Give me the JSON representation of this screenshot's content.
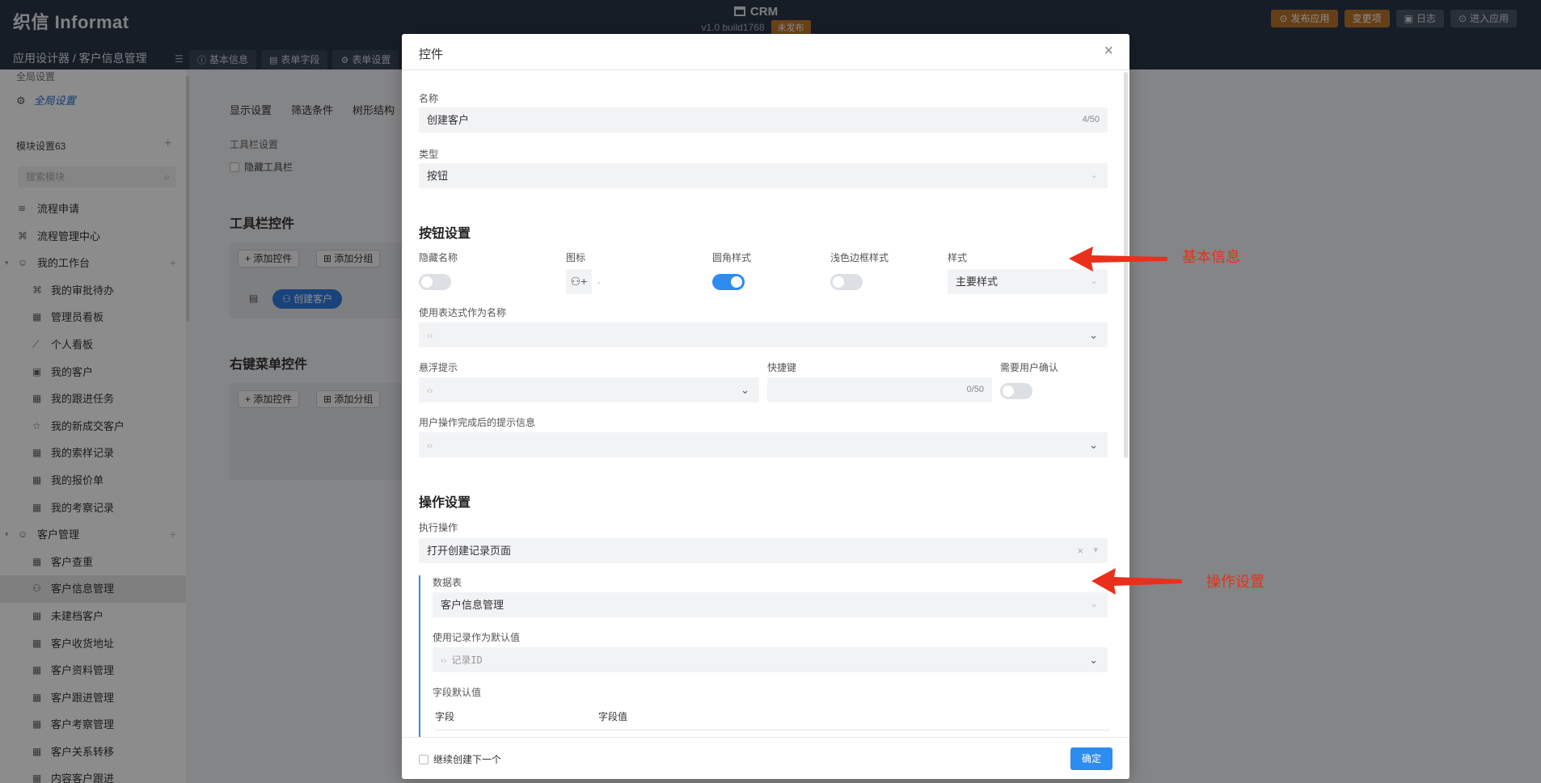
{
  "header": {
    "logo": "织信 Informat",
    "app_name": "CRM",
    "version": "v1.0 build1768",
    "status_badge": "未发布",
    "buttons": {
      "publish": "发布应用",
      "changes": "变更项",
      "log": "日志",
      "enter": "进入应用"
    },
    "breadcrumb": "应用设计器 / 客户信息管理",
    "tabs": [
      "基本信息",
      "表单字段",
      "表单设置"
    ]
  },
  "sidebar": {
    "global_section_title": "全局设置",
    "global_item": "全局设置",
    "module_title": "模块设置63",
    "search_placeholder": "搜索模块",
    "items": [
      {
        "label": "流程申请",
        "icon": "layers-icon",
        "level": 1
      },
      {
        "label": "流程管理中心",
        "icon": "flow-icon",
        "level": 1
      },
      {
        "label": "我的工作台",
        "icon": "smile-icon",
        "level": 1,
        "group": true
      },
      {
        "label": "我的审批待办",
        "icon": "flow-icon",
        "level": 2
      },
      {
        "label": "管理员看板",
        "icon": "board-icon",
        "level": 2
      },
      {
        "label": "个人看板",
        "icon": "chart-icon",
        "level": 2
      },
      {
        "label": "我的客户",
        "icon": "contact-icon",
        "level": 2
      },
      {
        "label": "我的跟进任务",
        "icon": "table-icon",
        "level": 2
      },
      {
        "label": "我的新成交客户",
        "icon": "star-icon",
        "level": 2
      },
      {
        "label": "我的索样记录",
        "icon": "table-icon",
        "level": 2
      },
      {
        "label": "我的报价单",
        "icon": "table-icon",
        "level": 2
      },
      {
        "label": "我的考察记录",
        "icon": "board-icon",
        "level": 2
      },
      {
        "label": "客户管理",
        "icon": "smile-icon",
        "level": 1,
        "group": true
      },
      {
        "label": "客户查重",
        "icon": "table-icon",
        "level": 2
      },
      {
        "label": "客户信息管理",
        "icon": "user-icon",
        "level": 2,
        "active": true
      },
      {
        "label": "未建档客户",
        "icon": "table-icon",
        "level": 2
      },
      {
        "label": "客户收货地址",
        "icon": "table-icon",
        "level": 2
      },
      {
        "label": "客户资料管理",
        "icon": "table-icon",
        "level": 2
      },
      {
        "label": "客户跟进管理",
        "icon": "table-icon",
        "level": 2
      },
      {
        "label": "客户考察管理",
        "icon": "table-icon",
        "level": 2
      },
      {
        "label": "客户关系转移",
        "icon": "table-icon",
        "level": 2
      },
      {
        "label": "内容客户跟进",
        "icon": "table-icon",
        "level": 2
      }
    ]
  },
  "background": {
    "sub_tabs": [
      "显示设置",
      "筛选条件",
      "树形结构"
    ],
    "toolbar_settings_label": "工具栏设置",
    "hide_toolbar": "隐藏工具栏",
    "toolbar_controls_title": "工具栏控件",
    "add_control": "添加控件",
    "add_group": "添加分组",
    "create_customer_btn": "创建客户",
    "context_menu_title": "右键菜单控件"
  },
  "modal": {
    "title": "控件",
    "name_label": "名称",
    "name_value": "创建客户",
    "name_count": "4/50",
    "type_label": "类型",
    "type_value": "按钮",
    "button_settings_title": "按钮设置",
    "hide_name_label": "隐藏名称",
    "hide_name_on": false,
    "icon_label": "图标",
    "rounded_label": "圆角样式",
    "rounded_on": true,
    "light_border_label": "浅色边框样式",
    "light_border_on": false,
    "style_label": "样式",
    "style_value": "主要样式",
    "expr_name_label": "使用表达式作为名称",
    "tooltip_label": "悬浮提示",
    "shortcut_label": "快捷键",
    "shortcut_count": "0/50",
    "confirm_label": "需要用户确认",
    "confirm_on": false,
    "done_msg_label": "用户操作完成后的提示信息",
    "action_settings_title": "操作设置",
    "exec_label": "执行操作",
    "exec_value": "打开创建记录页面",
    "table_label": "数据表",
    "table_value": "客户信息管理",
    "default_record_label": "使用记录作为默认值",
    "default_record_placeholder": "记录ID",
    "field_defaults_label": "字段默认值",
    "col_field": "字段",
    "col_value": "字段值",
    "continue_create": "继续创建下一个",
    "ok": "确定"
  },
  "annotations": {
    "basic_info": "基本信息",
    "action_settings": "操作设置",
    "arrow_color": "#e8301c"
  }
}
